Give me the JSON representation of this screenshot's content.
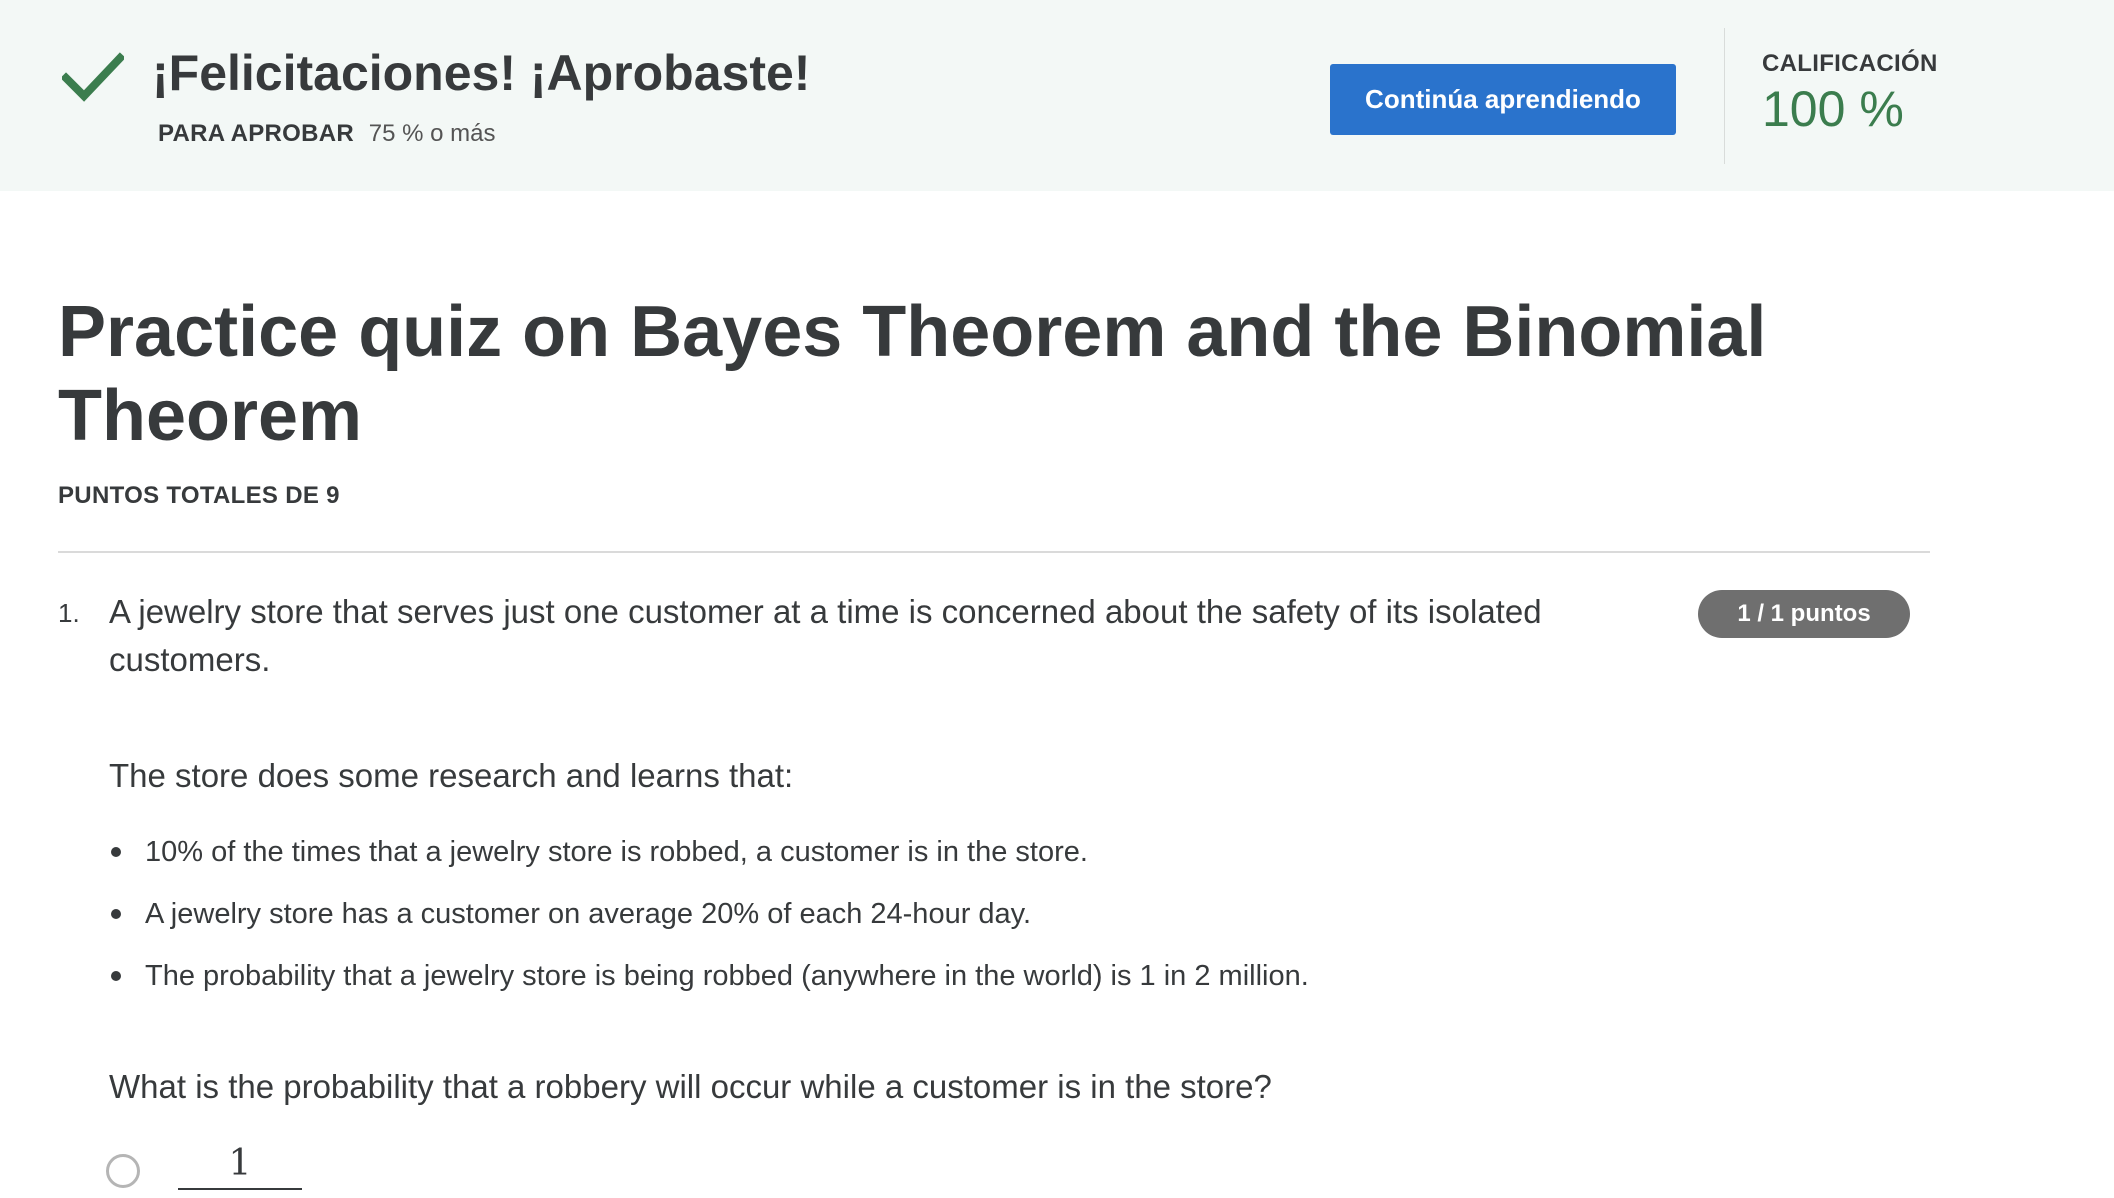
{
  "banner": {
    "title": "¡Felicitaciones! ¡Aprobaste!",
    "pass_label": "PARA APROBAR",
    "pass_value": "75 % o más",
    "continue_label": "Continúa aprendiendo",
    "grade_label": "CALIFICACIÓN",
    "grade_value": "100 %",
    "icon": "check-icon",
    "colors": {
      "background": "#f3f8f6",
      "check": "#3b7d4e",
      "button": "#2a73cc",
      "grade": "#3b7d4e"
    }
  },
  "quiz": {
    "title": "Practice quiz on Bayes Theorem and the Binomial Theorem",
    "points_total": "PUNTOS TOTALES DE 9"
  },
  "question": {
    "number": "1.",
    "text": "A jewelry store that serves just one customer at a time is concerned about the safety of its isolated customers.",
    "points": "1 / 1 puntos",
    "intro": "The store does some research and learns that:",
    "bullets": [
      "10% of the times that a jewelry store is robbed, a customer is in the store.",
      "A jewelry store has a customer on average 20% of each 24-hour day.",
      "The probability that a jewelry store is being robbed (anywhere in the world) is 1 in 2 million."
    ],
    "ask": "What is the probability that a robbery will occur while a customer is in the store?",
    "options": [
      {
        "numerator": "1"
      }
    ]
  }
}
